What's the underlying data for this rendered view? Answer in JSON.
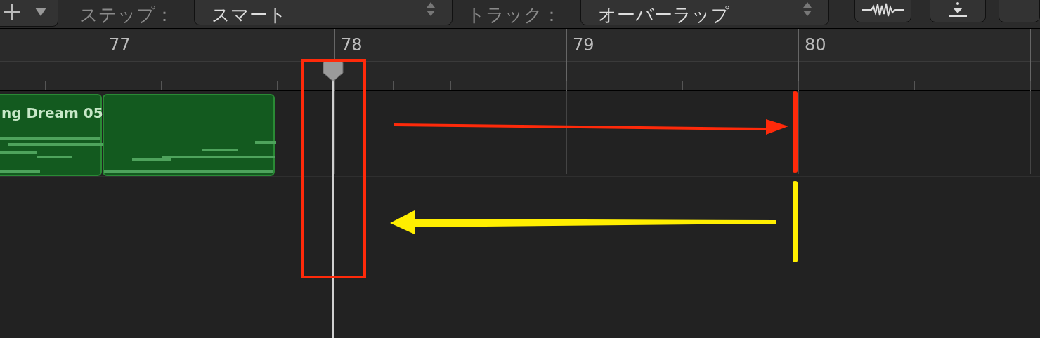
{
  "toolbar": {
    "step_label": "ステップ：",
    "step_value": "スマート",
    "track_label": "トラック：",
    "track_value": "オーバーラップ"
  },
  "ruler": {
    "bars": [
      "77",
      "78",
      "79",
      "80"
    ]
  },
  "regions": [
    {
      "kind": "labeled",
      "label": "ng Dream 05"
    },
    {
      "kind": "plain"
    }
  ]
}
